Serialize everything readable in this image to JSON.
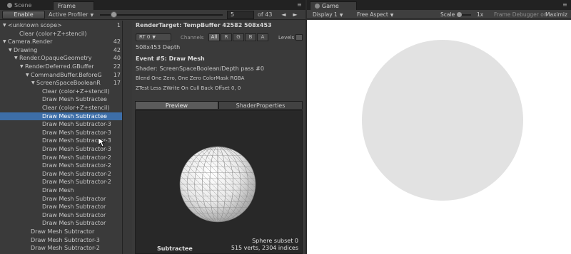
{
  "tabs_left": [
    {
      "label": "Scene",
      "icon": "scene-icon"
    },
    {
      "label": "Frame Debug",
      "icon": "frame-debug-icon"
    }
  ],
  "tabs_right": [
    {
      "label": "Game",
      "icon": "game-icon"
    }
  ],
  "toolbar": {
    "enable_label": "Enable",
    "profiler_label": "Active Profiler",
    "frame_value": "5",
    "frame_total": "of 43",
    "prev_label": "◄",
    "next_label": "►",
    "slider_fraction": 0.11
  },
  "tree": [
    {
      "label": "<unknown scope>",
      "count": "1",
      "indent": 0,
      "arrow": "▼",
      "selected": false
    },
    {
      "label": "Clear (color+Z+stencil)",
      "count": "",
      "indent": 2,
      "arrow": "",
      "selected": false
    },
    {
      "label": "Camera.Render",
      "count": "42",
      "indent": 0,
      "arrow": "▼",
      "selected": false
    },
    {
      "label": "Drawing",
      "count": "42",
      "indent": 1,
      "arrow": "▼",
      "selected": false
    },
    {
      "label": "Render.OpaqueGeometry",
      "count": "40",
      "indent": 2,
      "arrow": "▼",
      "selected": false
    },
    {
      "label": "RenderDeferred.GBuffer",
      "count": "22",
      "indent": 3,
      "arrow": "▼",
      "selected": false
    },
    {
      "label": "CommandBuffer.BeforeG",
      "count": "17",
      "indent": 4,
      "arrow": "▼",
      "selected": false
    },
    {
      "label": "ScreenSpaceBooleanR",
      "count": "17",
      "indent": 5,
      "arrow": "▼",
      "selected": false
    },
    {
      "label": "Clear (color+Z+stencil)",
      "count": "",
      "indent": 6,
      "arrow": "",
      "selected": false
    },
    {
      "label": "Draw Mesh Subtractee",
      "count": "",
      "indent": 6,
      "arrow": "",
      "selected": false
    },
    {
      "label": "Clear (color+Z+stencil)",
      "count": "",
      "indent": 6,
      "arrow": "",
      "selected": false
    },
    {
      "label": "Draw Mesh Subtractee",
      "count": "",
      "indent": 6,
      "arrow": "",
      "selected": true
    },
    {
      "label": "Draw Mesh Subtractor-3",
      "count": "",
      "indent": 6,
      "arrow": "",
      "selected": false
    },
    {
      "label": "Draw Mesh Subtractor-3",
      "count": "",
      "indent": 6,
      "arrow": "",
      "selected": false
    },
    {
      "label": "Draw Mesh Subtractor-3",
      "count": "",
      "indent": 6,
      "arrow": "",
      "selected": false
    },
    {
      "label": "Draw Mesh Subtractor-3",
      "count": "",
      "indent": 6,
      "arrow": "",
      "selected": false
    },
    {
      "label": "Draw Mesh Subtractor-2",
      "count": "",
      "indent": 6,
      "arrow": "",
      "selected": false
    },
    {
      "label": "Draw Mesh Subtractor-2",
      "count": "",
      "indent": 6,
      "arrow": "",
      "selected": false
    },
    {
      "label": "Draw Mesh Subtractor-2",
      "count": "",
      "indent": 6,
      "arrow": "",
      "selected": false
    },
    {
      "label": "Draw Mesh Subtractor-2",
      "count": "",
      "indent": 6,
      "arrow": "",
      "selected": false
    },
    {
      "label": "Draw Mesh",
      "count": "",
      "indent": 6,
      "arrow": "",
      "selected": false
    },
    {
      "label": "Draw Mesh Subtractor",
      "count": "",
      "indent": 6,
      "arrow": "",
      "selected": false
    },
    {
      "label": "Draw Mesh Subtractor",
      "count": "",
      "indent": 6,
      "arrow": "",
      "selected": false
    },
    {
      "label": "Draw Mesh Subtractor",
      "count": "",
      "indent": 6,
      "arrow": "",
      "selected": false
    },
    {
      "label": "Draw Mesh Subtractor",
      "count": "",
      "indent": 6,
      "arrow": "",
      "selected": false
    },
    {
      "label": "Draw Mesh Subtractor",
      "count": "",
      "indent": 4,
      "arrow": "",
      "selected": false
    },
    {
      "label": "Draw Mesh Subtractor-3",
      "count": "",
      "indent": 4,
      "arrow": "",
      "selected": false
    },
    {
      "label": "Draw Mesh Subtractor-2",
      "count": "",
      "indent": 4,
      "arrow": "",
      "selected": false
    }
  ],
  "detail": {
    "render_target": "RenderTarget: TempBuffer 42582 508x453",
    "rt_select": "RT 0",
    "channels_label": "Channels",
    "channels": [
      "All",
      "R",
      "G",
      "B",
      "A"
    ],
    "levels_label": "Levels",
    "depth_info": "508x453 Depth",
    "event_title": "Event #5: Draw Mesh",
    "shader": "Shader: ScreenSpaceBoolean/Depth pass #0",
    "blend": "Blend One Zero, One Zero ColorMask RGBA",
    "ztest": "ZTest Less ZWrite On Cull Back Offset 0, 0",
    "subtab_preview": "Preview",
    "subtab_props": "ShaderProperties",
    "preview_mesh": "Subtractee",
    "preview_subset": "Sphere subset 0",
    "preview_stats": "515 verts, 2304 indices"
  },
  "game_toolbar": {
    "display": "Display 1",
    "aspect": "Free Aspect",
    "scale_label": "Scale",
    "scale_value": "1x",
    "frame_debugger_on": "Frame Debugger on",
    "maximize": "Maximiz"
  },
  "menu_icon": "≡",
  "colors": {
    "selection": "#3d6ea8",
    "panel": "#3a3a3a",
    "viewport_bg": "#ffffff",
    "sphere": "#e2e2e2"
  }
}
